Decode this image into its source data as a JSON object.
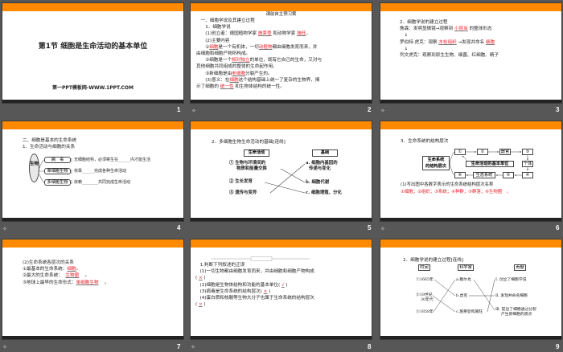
{
  "slides": [
    {
      "number": "1",
      "title": "第1节  细胞是生命活动的基本单位",
      "subtitle": "第一PPT模板网-WWW.1PPT.COM"
    },
    {
      "number": "2",
      "heading": "课前自主预习案",
      "lines": [
        [
          {
            "t": "　一、细胞学说及其建立过程"
          }
        ],
        [
          {
            "t": "　　1．细胞学说"
          }
        ],
        [
          {
            "t": "　　(1)创立者：德国植物学家 "
          },
          {
            "t": "施莱登",
            "hl": true
          },
          {
            "t": " 和动物学家 "
          },
          {
            "t": "施旺",
            "hl": true
          },
          {
            "t": "。"
          }
        ],
        [
          {
            "t": "　　(2)主要内容"
          }
        ],
        [
          {
            "t": "　　①"
          },
          {
            "t": "细胞",
            "hl": true
          },
          {
            "t": "是一个有机体，一切"
          },
          {
            "t": "动植物",
            "hl": true
          },
          {
            "t": "都由细胞发育而来，并"
          }
        ],
        [
          {
            "t": "由细胞和细胞产物所构成。"
          }
        ],
        [
          {
            "t": "　　②细胞是一个"
          },
          {
            "t": "相对独立",
            "hl": true
          },
          {
            "t": "的单位，既有它自己的生命，又对与"
          }
        ],
        [
          {
            "t": "其他细胞共同组成的整体的生命起作用。"
          }
        ],
        [
          {
            "t": "　　③新细胞是由"
          },
          {
            "t": "老细胞",
            "hl": true
          },
          {
            "t": "分裂产生的。"
          }
        ],
        [
          {
            "t": "　　(3)意义：在"
          },
          {
            "t": "细胞",
            "hl": true
          },
          {
            "t": "这个结构基础上统一了复杂的生物界，揭"
          }
        ],
        [
          {
            "t": "示了细胞的 "
          },
          {
            "t": "统一性",
            "hl": true
          },
          {
            "t": " 和生物体结构的统一性。"
          }
        ]
      ]
    },
    {
      "number": "3",
      "lines": [
        [
          {
            "t": "2．细胞学说的建立过程"
          }
        ],
        [
          {
            "t": "詹森：发明显微镜→观察到 "
          },
          {
            "t": "小昆虫",
            "hl": true
          },
          {
            "t": " 的整体形态"
          }
        ],
        [
          {
            "t": "　↓"
          }
        ],
        [
          {
            "t": "罗伯特·虎克：观察 "
          },
          {
            "t": "木栓组织",
            "hl": true
          },
          {
            "t": " →发现并命名 "
          },
          {
            "t": "细胞",
            "hl": true
          }
        ],
        [
          {
            "t": "　↓"
          }
        ],
        [
          {
            "t": "列文虎克：观察到原生生物、细菌、红细胞、精子"
          }
        ]
      ]
    },
    {
      "number": "4",
      "lines": [
        [
          {
            "t": "二、细胞是基本的生命系统"
          }
        ],
        [
          {
            "t": "1．生命活动与细胞的关系"
          }
        ]
      ],
      "organism": "生物",
      "boxes": [
        "病　毒",
        "单细胞生物",
        "多细胞生物"
      ],
      "desc": [
        "无细胞结构，必须寄生在______内才能生活",
        "依靠______完成各种生命活动",
        "依赖________共同完成生命活动"
      ]
    },
    {
      "number": "5",
      "lines": [
        [
          {
            "t": "2．多细胞生物生命活动的基础[连线]"
          }
        ]
      ],
      "left_header": "生命活动",
      "right_header": "基础",
      "left": [
        "① 生物与环境间的",
        "物质和能量交换",
        "② 生长发育",
        "③ 遗传与变异"
      ],
      "right": [
        "a. 细胞内基因的",
        "传递与变化",
        "b. 细胞代谢",
        "c. 细胞增殖、分化"
      ]
    },
    {
      "number": "6",
      "lines": [
        [
          {
            "t": "3．生命系统的结构层次"
          }
        ]
      ],
      "root": [
        "生命系统",
        "的结构层次"
      ],
      "nodes": [
        "①",
        "②",
        "器官",
        "③",
        "个体",
        "④",
        "⑤",
        "生态系统",
        "⑥"
      ],
      "note": "生命活动的基本单位",
      "question": "(1)写出图中各数字表示的生命系统结构层次名称",
      "answer": [
        {
          "t": "①"
        },
        {
          "t": "细胞",
          "hl": true
        },
        {
          "t": "；②"
        },
        {
          "t": "组织",
          "hl": true
        },
        {
          "t": "；③"
        },
        {
          "t": "系统",
          "hl": true
        },
        {
          "t": "；④"
        },
        {
          "t": "种群",
          "hl": true
        },
        {
          "t": "；⑤"
        },
        {
          "t": "群落",
          "hl": true
        },
        {
          "t": "；⑥"
        },
        {
          "t": "生物圈",
          "hl": true
        },
        {
          "t": "　。"
        }
      ]
    },
    {
      "number": "7",
      "lines": [
        [
          {
            "t": "(2)生命系统各层次的关系"
          }
        ],
        [
          {
            "t": "①最基本的生命系统："
          },
          {
            "t": "细胞",
            "hl": true
          },
          {
            "t": "。"
          }
        ],
        [
          {
            "t": "②最大的生命系统：  "
          },
          {
            "t": "生物圈",
            "hl": true
          },
          {
            "t": "　 。"
          }
        ],
        [
          {
            "t": "③地球上最早的生命形式："
          },
          {
            "t": "单细胞生物",
            "hl": true
          },
          {
            "t": "　 。"
          }
        ]
      ]
    },
    {
      "number": "8",
      "lines": [
        [
          {
            "t": "　1.判断下列叙述的正误"
          }
        ],
        [
          {
            "t": "　(1)一切生物都由细胞发育而来，并由细胞和细胞产物构成"
          }
        ],
        [
          {
            "t": "( "
          },
          {
            "t": "×",
            "hl": true
          },
          {
            "t": " )"
          }
        ],
        [
          {
            "t": "　(2)细胞是生物体结构和功能的基本单位( "
          },
          {
            "t": "√",
            "hl": true
          },
          {
            "t": " )"
          }
        ],
        [
          {
            "t": "　(3)病毒是生命系统的结构层次( "
          },
          {
            "t": "×",
            "hl": true
          },
          {
            "t": " )"
          }
        ],
        [
          {
            "t": "　(4)蛋白质和核酸等生物大分子也属于生命系统的结构层次"
          }
        ],
        [
          {
            "t": "( "
          },
          {
            "t": "×",
            "hl": true
          },
          {
            "t": " )"
          }
        ]
      ]
    },
    {
      "number": "9",
      "lines": [
        [
          {
            "t": "2．细胞学说的建立过程[连线]"
          }
        ]
      ],
      "headers": [
        "时间",
        "科学家",
        "贡献"
      ],
      "times": [
        "①1665年",
        "②19世纪",
        "30年代",
        "③1858年"
      ],
      "scientists": [
        "a.魏尔肖",
        "b.虎克",
        "c.施莱登和施旺"
      ],
      "contributions": [
        "Ⅰ. 创立了细胞学说",
        "Ⅱ. 发现并命名细胞",
        "Ⅲ. 提出了细胞通过分裂",
        "产生新细胞的观点"
      ]
    }
  ]
}
